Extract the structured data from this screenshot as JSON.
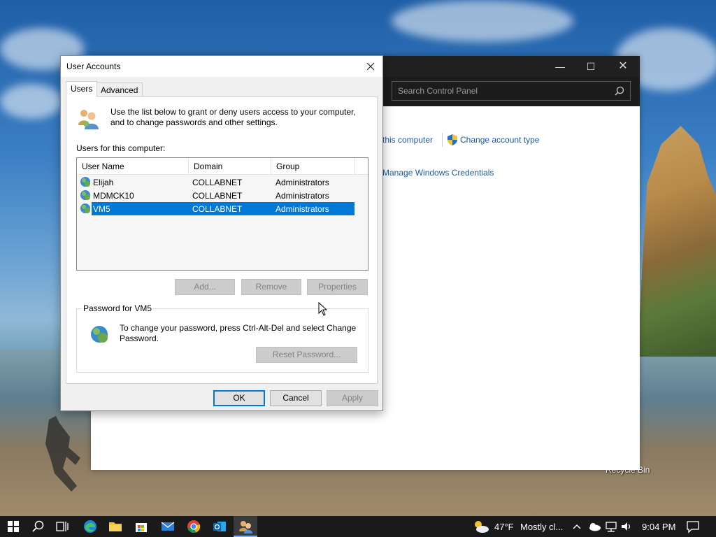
{
  "desktop": {
    "recycle_bin_label": "Recycle Bin"
  },
  "control_panel": {
    "search_placeholder": "Search Control Panel",
    "link_this_computer": "this computer",
    "link_change_account_type": "Change account type",
    "link_manage_credentials": "Manage Windows Credentials"
  },
  "dialog": {
    "title": "User Accounts",
    "tabs": [
      "Users",
      "Advanced"
    ],
    "active_tab": "Users",
    "intro_text": "Use the list below to grant or deny users access to your computer, and to change passwords and other settings.",
    "users_heading": "Users for this computer:",
    "columns": [
      "User Name",
      "Domain",
      "Group"
    ],
    "users": [
      {
        "name": "Elijah",
        "domain": "COLLABNET",
        "group": "Administrators",
        "selected": false
      },
      {
        "name": "MDMCK10",
        "domain": "COLLABNET",
        "group": "Administrators",
        "selected": false
      },
      {
        "name": "VM5",
        "domain": "COLLABNET",
        "group": "Administrators",
        "selected": true
      }
    ],
    "buttons": {
      "add": "Add...",
      "remove": "Remove",
      "properties": "Properties",
      "reset_password": "Reset Password...",
      "ok": "OK",
      "cancel": "Cancel",
      "apply": "Apply"
    },
    "password_group_label": "Password for VM5",
    "password_text": "To change your password, press Ctrl-Alt-Del and select Change Password."
  },
  "taskbar": {
    "weather_temp": "47°F",
    "weather_desc": "Mostly cl...",
    "time": "9:04 PM",
    "icons": [
      "windows-start-icon",
      "search-icon",
      "task-view-icon",
      "edge-icon",
      "file-explorer-icon",
      "store-icon",
      "mail-icon",
      "chrome-icon",
      "outlook-icon",
      "user-accounts-icon"
    ]
  },
  "colors": {
    "selection": "#0078d7",
    "link": "#1a5aa6",
    "taskbar": "#1a1a1a"
  }
}
